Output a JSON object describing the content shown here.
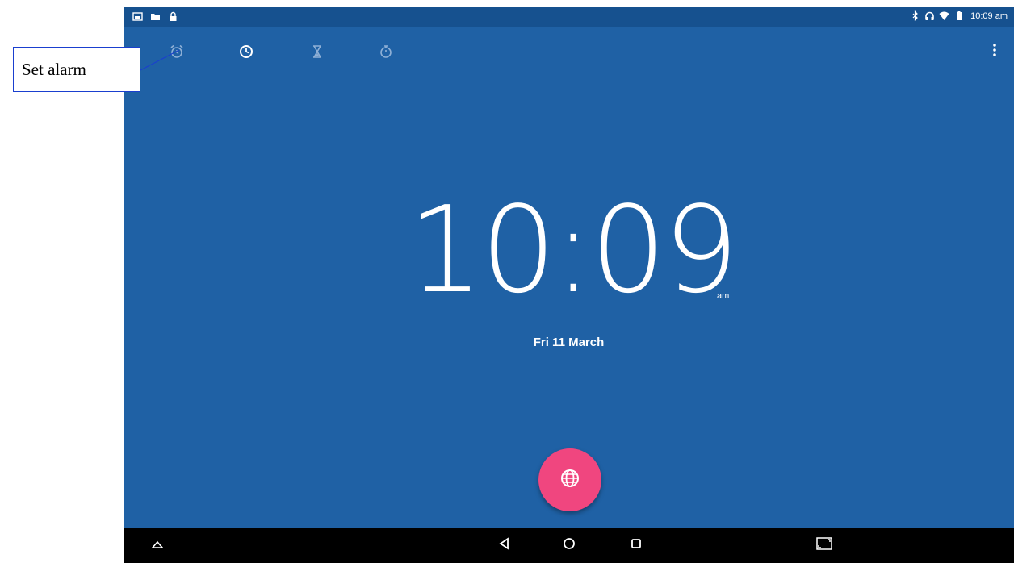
{
  "status_bar": {
    "time": "10:09 am",
    "left_icons": [
      "image-icon",
      "folder-icon",
      "lock-icon"
    ],
    "right_icons": [
      "bluetooth-icon",
      "headphones-icon",
      "wifi-icon",
      "battery-icon"
    ]
  },
  "toolbar": {
    "tabs": [
      {
        "name": "alarm",
        "icon": "alarm-icon"
      },
      {
        "name": "clock",
        "icon": "clock-icon",
        "active": true
      },
      {
        "name": "timer",
        "icon": "hourglass-icon"
      },
      {
        "name": "stopwatch",
        "icon": "stopwatch-icon"
      }
    ],
    "overflow_icon": "more-vert-icon"
  },
  "clock": {
    "time": "10:09",
    "ampm": "am",
    "date": "Fri 11 March"
  },
  "fab": {
    "icon": "globe-icon",
    "color": "#f0467f"
  },
  "nav_bar": {
    "buttons": [
      "up-arrow-icon",
      "back-icon",
      "home-icon",
      "recents-icon",
      "screenshot-icon"
    ]
  },
  "annotation": {
    "label": "Set alarm",
    "border_color": "#1a3fcf"
  },
  "colors": {
    "background": "#1f61a5",
    "status_bar": "#16518f",
    "nav_bar": "#000000"
  }
}
